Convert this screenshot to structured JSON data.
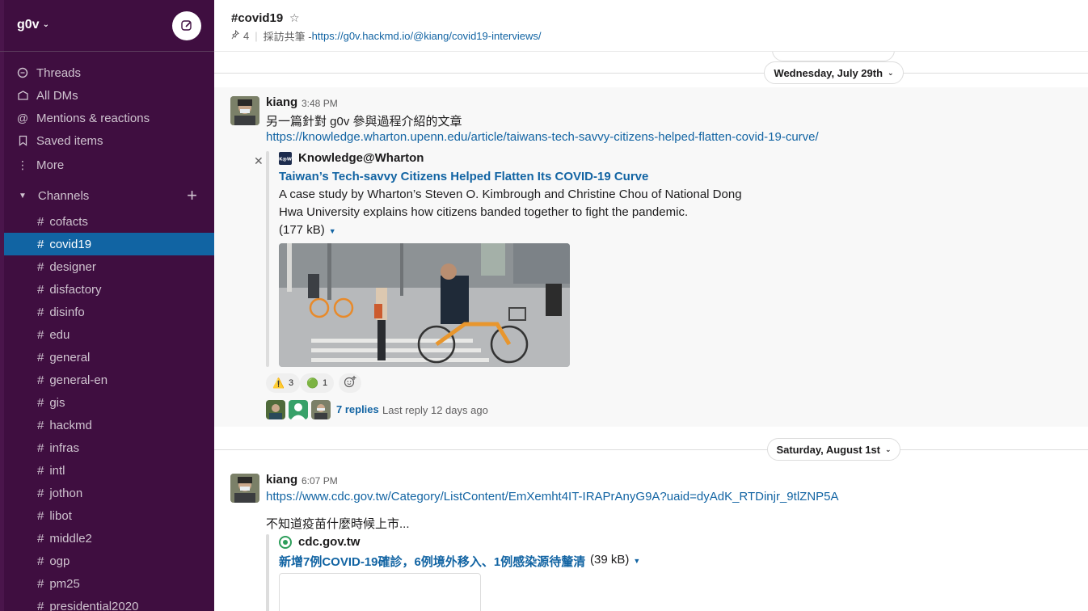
{
  "workspace": {
    "name": "g0v"
  },
  "sidebar": {
    "nav": [
      {
        "label": "Threads",
        "icon": "threads-icon"
      },
      {
        "label": "All DMs",
        "icon": "dm-icon"
      },
      {
        "label": "Mentions & reactions",
        "icon": "mention-icon"
      },
      {
        "label": "Saved items",
        "icon": "bookmark-icon"
      },
      {
        "label": "More",
        "icon": "more-icon"
      }
    ],
    "channels_label": "Channels",
    "channels": [
      "cofacts",
      "covid19",
      "designer",
      "disfactory",
      "disinfo",
      "edu",
      "general",
      "general-en",
      "gis",
      "hackmd",
      "infras",
      "intl",
      "jothon",
      "libot",
      "middle2",
      "ogp",
      "pm25",
      "presidential2020"
    ],
    "active_channel": "covid19"
  },
  "header": {
    "title": "#covid19",
    "pins": "4",
    "topic_prefix": "採訪共筆 - ",
    "topic_link": "https://g0v.hackmd.io/@kiang/covid19-interviews/"
  },
  "days": {
    "first": "Wednesday, July 29th",
    "second": "Saturday, August 1st"
  },
  "messages": [
    {
      "sender": "kiang",
      "time": "3:48 PM",
      "text": "另一篇針對 g0v 參與過程介紹的文章",
      "link": "https://knowledge.wharton.upenn.edu/article/taiwans-tech-savvy-citizens-helped-flatten-covid-19-curve/",
      "attachment": {
        "site": "Knowledge@Wharton",
        "title": "Taiwan’s Tech-savvy Citizens Helped Flatten Its COVID-19 Curve",
        "desc": "A case study by Wharton’s Steven O. Kimbrough and Christine Chou of National Dong Hwa University explains how citizens banded together to fight the pandemic.",
        "size": "(177 kB)"
      },
      "reactions": [
        {
          "count": "3"
        },
        {
          "count": "1"
        }
      ],
      "thread": {
        "replies": "7 replies",
        "last": "Last reply 12 days ago"
      }
    },
    {
      "sender": "kiang",
      "time": "6:07 PM",
      "link": "https://www.cdc.gov.tw/Category/ListContent/EmXemht4IT-IRAPrAnyG9A?uaid=dyAdK_RTDinjr_9tlZNP5A",
      "text": "不知道疫苗什麼時候上市...",
      "attachment": {
        "site": "cdc.gov.tw",
        "title": "新增7例COVID-19確診，6例境外移入、1例感染源待釐清",
        "size": "(39 kB)"
      }
    }
  ],
  "colors": {
    "sidebar_bg": "#3f0e40",
    "active_channel": "#1164a3",
    "link": "#1264a3"
  }
}
